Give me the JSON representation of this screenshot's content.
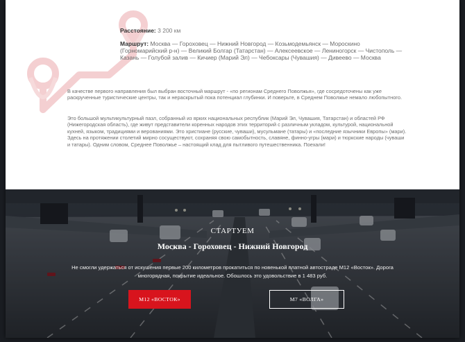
{
  "info": {
    "distance_label": "Расстояние:",
    "distance_value": "3 200 км",
    "route_label": "Маршрут:",
    "route_value": "Москва — Гороховец — Нижний Новгород — Козьмодемьянск — Мороскино (Горномарийский р-н) — Великий Болгар (Татарстан) — Алексеевское — Лениногорск — Чистополь — Казань — Голубой залив — Кичиер (Марий Эл) — Чебоксары (Чувашия) — Дивеево — Москва"
  },
  "paragraphs": [
    "В качестве первого направления был выбран восточный маршрут - «по регионам Среднего Поволжья», где сосредоточены как уже раскрученные туристические центры, так и нераскрытый пока потенциал глубинки. И поверьте, в Среднем Поволжье немало любопытного.",
    "Это большой мультикультурный пазл, собранный из ярких национальных республик (Марий Эл, Чувашия, Татарстан) и областей РФ (Нижегородская область), где живут представители коренных народов этих территорий с различным укладом, культурой, национальной кухней, языком, традициями и верованиями. Это христиане (русские, чуваши), мусульмане (татары) и «последние язычники Европы» (мари). Здесь на протяжении столетий мирно сосуществуют, сохраняя свою самобытность, славяне, финно-угры (мари) и тюркские народы (чуваши и татары). Одним словом, Среднее Поволжье – настоящий клад для пытливого путешественника. Поехали!"
  ],
  "hero": {
    "title": "СТАРТУЕМ",
    "subtitle": "Москва - Гороховец - Нижний Новгород",
    "description": "Не смогли удержаться от искушения первые 200 километров прокатиться по новенькой платной автостраде М12 «Восток». Дорога многорядная, покрытие идеальное. Обошлось это удовольствие в 1 483 руб.",
    "button_primary": "М12 «ВОСТОК»",
    "button_secondary": "М7 «ВОЛГА»"
  },
  "colors": {
    "accent": "#d8141d",
    "decor_pin": "#f2c4c6"
  }
}
